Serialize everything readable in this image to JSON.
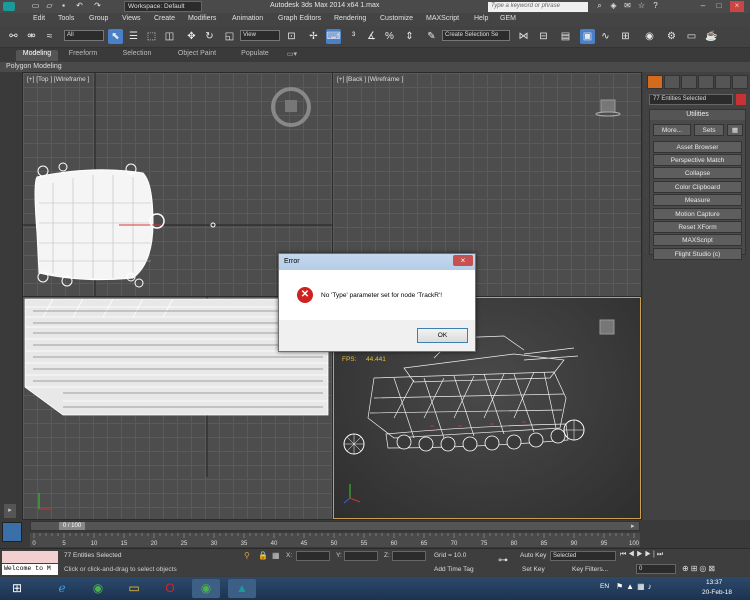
{
  "titlebar": {
    "workspace": "Workspace: Default",
    "title": "Autodesk 3ds Max  2014 x64      1.max",
    "search_placeholder": "Type a keyword or phrase"
  },
  "menu": [
    "Edit",
    "Tools",
    "Group",
    "Views",
    "Create",
    "Modifiers",
    "Animation",
    "Graph Editors",
    "Rendering",
    "Customize",
    "MAXScript",
    "Help",
    "GEM"
  ],
  "toolbar": {
    "filter": "All",
    "refcoord": "View",
    "selset": "Create Selection Se"
  },
  "ribbon": {
    "tabs": [
      "Modeling",
      "Freeform",
      "Selection",
      "Object Paint",
      "Populate"
    ],
    "active": "Modeling",
    "sub": "Polygon Modeling"
  },
  "viewports": {
    "top_left": "[+] [Top ] [Wireframe ]",
    "top_right": "[+] [Back ] [Wireframe ]",
    "fps_label": "FPS:",
    "fps_value": "44.441"
  },
  "command_panel": {
    "selection": "77 Entities Selected",
    "utilities_title": "Utilities",
    "more": "More...",
    "sets": "Sets",
    "buttons": [
      "Asset Browser",
      "Perspective Match",
      "Collapse",
      "Color Clipboard",
      "Measure",
      "Motion Capture",
      "Reset XForm",
      "MAXScript",
      "Flight Studio (c)"
    ]
  },
  "timeline": {
    "frame": "0 / 100",
    "ticks": [
      "0",
      "5",
      "10",
      "15",
      "20",
      "25",
      "30",
      "35",
      "40",
      "45",
      "50",
      "55",
      "60",
      "65",
      "70",
      "75",
      "80",
      "85",
      "90",
      "95",
      "100"
    ]
  },
  "status": {
    "selected": "77 Entities Selected",
    "prompt": "Click or click-and-drag to select objects",
    "x_label": "X:",
    "y_label": "Y:",
    "z_label": "Z:",
    "grid": "Grid = 10.0",
    "add_time_tag": "Add Time Tag",
    "auto_key": "Auto Key",
    "auto_key_mode": "Selected",
    "set_key": "Set Key",
    "key_filters": "Key Filters...",
    "frame_value": "0",
    "maxscript": "Welcome to M"
  },
  "error_dialog": {
    "title": "Error",
    "message": "No 'Type' parameter set for node 'TrackR'!",
    "ok": "OK"
  },
  "taskbar": {
    "lang": "EN",
    "time": "13:37",
    "date": "20-Feb-18"
  }
}
